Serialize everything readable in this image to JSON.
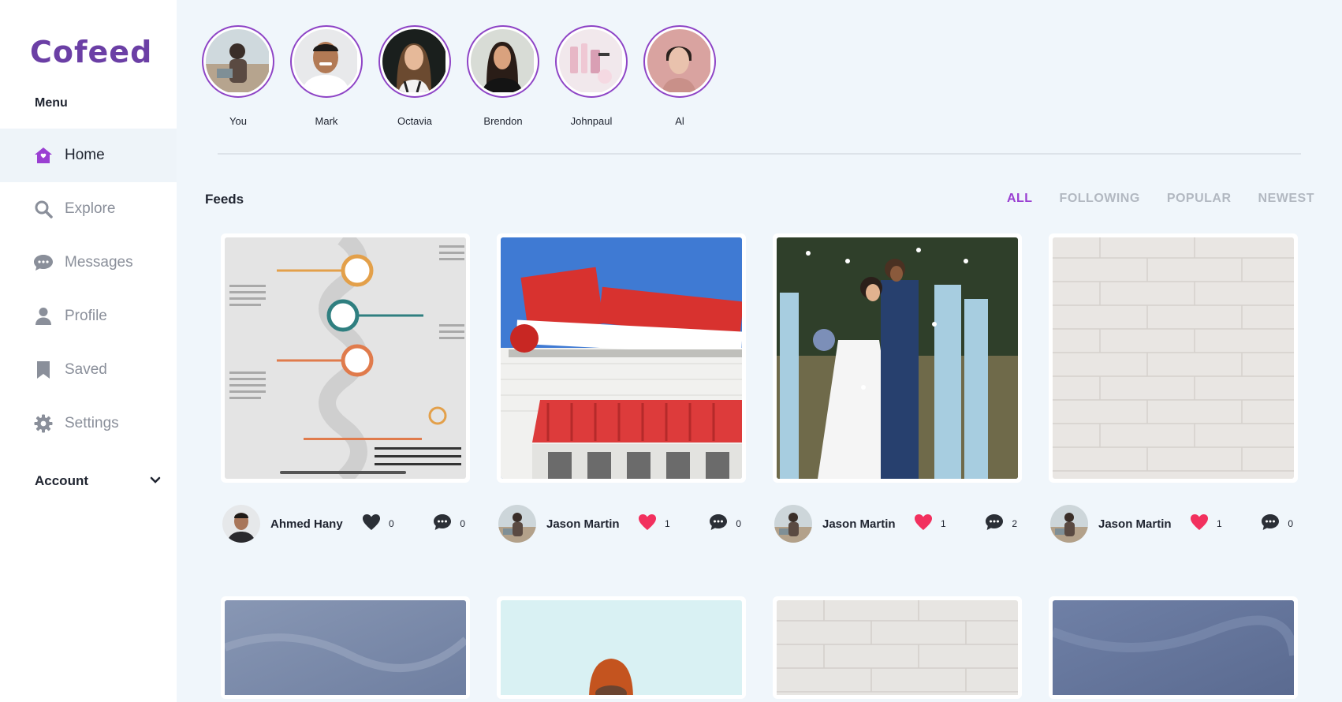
{
  "app": {
    "logo": "Cofeed"
  },
  "sidebar": {
    "menu_heading": "Menu",
    "items": [
      {
        "label": "Home",
        "icon": "home-icon",
        "active": true
      },
      {
        "label": "Explore",
        "icon": "search-icon",
        "active": false
      },
      {
        "label": "Messages",
        "icon": "chat-bubble-icon",
        "active": false
      },
      {
        "label": "Profile",
        "icon": "person-icon",
        "active": false
      },
      {
        "label": "Saved",
        "icon": "bookmark-icon",
        "active": false
      },
      {
        "label": "Settings",
        "icon": "gear-icon",
        "active": false
      }
    ],
    "account_label": "Account"
  },
  "stories": [
    {
      "name": "You"
    },
    {
      "name": "Mark"
    },
    {
      "name": "Octavia"
    },
    {
      "name": "Brendon"
    },
    {
      "name": "Johnpaul"
    },
    {
      "name": "Al"
    }
  ],
  "feeds": {
    "title": "Feeds",
    "filters": [
      "ALL",
      "FOLLOWING",
      "POPULAR",
      "NEWEST"
    ],
    "active_filter": "ALL",
    "posts": [
      {
        "author": "Ahmed Hany",
        "likes": "0",
        "comments": "0",
        "liked": false
      },
      {
        "author": "Jason Martin",
        "likes": "1",
        "comments": "0",
        "liked": true
      },
      {
        "author": "Jason Martin",
        "likes": "1",
        "comments": "2",
        "liked": true
      },
      {
        "author": "Jason Martin",
        "likes": "1",
        "comments": "0",
        "liked": true
      }
    ]
  },
  "colors": {
    "brand": "#6b3fa5",
    "accent": "#9a3fd2",
    "like": "#f2305e",
    "background": "#f0f6fb"
  }
}
